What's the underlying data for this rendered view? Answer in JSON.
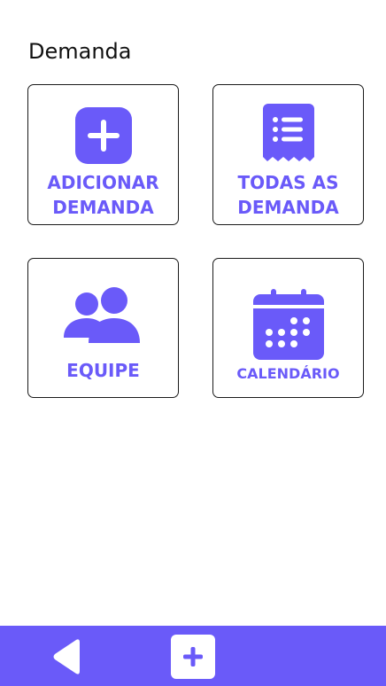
{
  "page": {
    "title": "Demanda"
  },
  "tiles": [
    {
      "id": "add",
      "icon": "add-square-icon",
      "label_lines": [
        "ADICIONAR",
        "DEMANDA"
      ]
    },
    {
      "id": "all",
      "icon": "receipt-list-icon",
      "label_lines": [
        "TODAS AS",
        "DEMANDA"
      ]
    },
    {
      "id": "team",
      "icon": "team-users-icon",
      "label_lines": [
        "EQUIPE"
      ]
    },
    {
      "id": "calendar",
      "icon": "calendar-icon",
      "label_lines": [
        "CALENDÁRIO"
      ]
    }
  ],
  "bottom_bar": {
    "back_icon": "back-triangle-icon",
    "add_icon": "plus-icon"
  },
  "colors": {
    "accent": "#6a5af9",
    "border": "#1a1a1a",
    "background": "#ffffff",
    "text": "#111111"
  }
}
